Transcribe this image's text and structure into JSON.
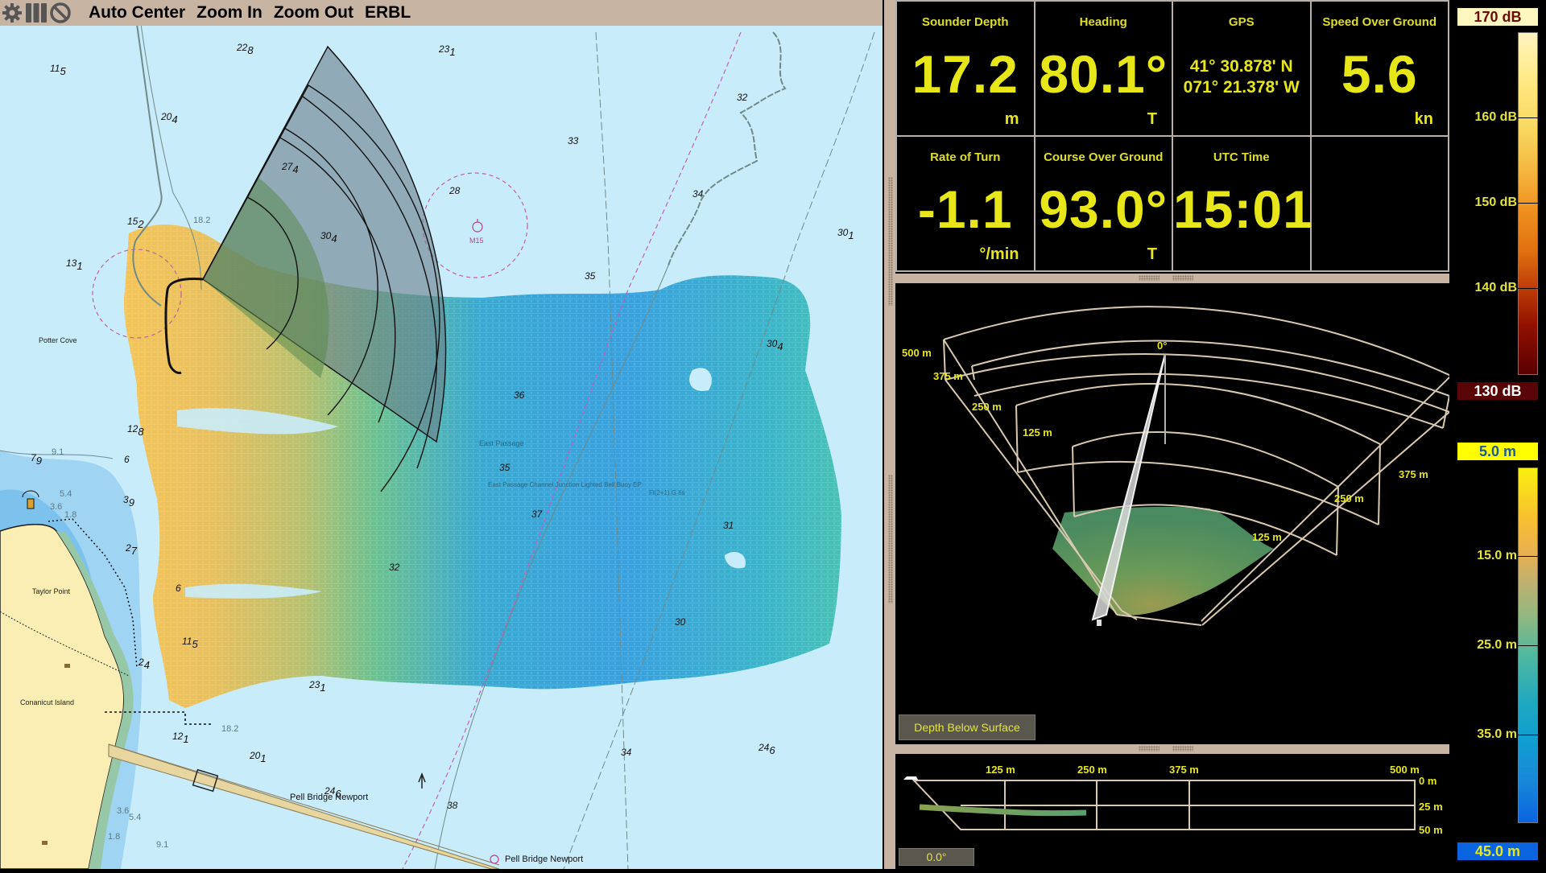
{
  "toolbar": {
    "icons": [
      "gear-icon",
      "columns-icon",
      "no-entry-icon"
    ],
    "buttons": [
      "Auto Center",
      "Zoom In",
      "Zoom Out",
      "ERBL"
    ]
  },
  "instruments": [
    {
      "label": "Sounder Depth",
      "value": "17.2",
      "unit": "m"
    },
    {
      "label": "Heading",
      "value": "80.1°",
      "unit": "T"
    },
    {
      "label": "GPS",
      "lat": "41° 30.878' N",
      "lon": "071° 21.378' W"
    },
    {
      "label": "Speed Over Ground",
      "value": "5.6",
      "unit": "kn"
    },
    {
      "label": "Rate of Turn",
      "value": "-1.1",
      "unit": "°/min"
    },
    {
      "label": "Course Over Ground",
      "value": "93.0°",
      "unit": "T"
    },
    {
      "label": "UTC Time",
      "value": "15:01",
      "unit": ""
    },
    {
      "label": "",
      "value": "",
      "unit": ""
    }
  ],
  "map": {
    "soundings": [
      {
        "t": "11",
        "s": "5"
      },
      {
        "t": "22",
        "s": "8"
      },
      {
        "t": "23",
        "s": "1"
      },
      {
        "t": "20",
        "s": "4"
      },
      {
        "t": "27",
        "s": "4"
      },
      {
        "t": "28",
        "s": ""
      },
      {
        "t": "30",
        "s": "4"
      },
      {
        "t": "15",
        "s": "2"
      },
      {
        "t": "13",
        "s": "1"
      },
      {
        "t": "33",
        "s": ""
      },
      {
        "t": "32",
        "s": ""
      },
      {
        "t": "34",
        "s": ""
      },
      {
        "t": "35",
        "s": ""
      },
      {
        "t": "30",
        "s": "1"
      },
      {
        "t": "12",
        "s": "8"
      },
      {
        "t": "7",
        "s": "9"
      },
      {
        "t": "6",
        "s": ""
      },
      {
        "t": "3",
        "s": "9"
      },
      {
        "t": "2",
        "s": "7"
      },
      {
        "t": "6",
        "s": ""
      },
      {
        "t": "2",
        "s": "4"
      },
      {
        "t": "12",
        "s": "1"
      },
      {
        "t": "20",
        "s": "1"
      },
      {
        "t": "23",
        "s": "1"
      },
      {
        "t": "24",
        "s": "6"
      },
      {
        "t": "38",
        "s": ""
      },
      {
        "t": "34",
        "s": ""
      },
      {
        "t": "24",
        "s": "6"
      },
      {
        "t": "30",
        "s": "4"
      },
      {
        "t": "36",
        "s": ""
      },
      {
        "t": "35",
        "s": ""
      },
      {
        "t": "37",
        "s": ""
      },
      {
        "t": "31",
        "s": ""
      },
      {
        "t": "32",
        "s": ""
      },
      {
        "t": "30",
        "s": ""
      },
      {
        "t": "11",
        "s": "5"
      }
    ],
    "contour_labels": [
      "18.2",
      "9.1",
      "5.4",
      "3.6",
      "1.8",
      "18.2",
      "9.1",
      "5.4",
      "3.6",
      "1.8"
    ],
    "places": [
      "Potter Cove",
      "Taylor Point",
      "Conanicut Island",
      "Pell Bridge Newport",
      "Pell Bridge Newport",
      "East Passage",
      "East Passage Channel Junction Lighted Bell Buoy EP",
      "Fl(2+1) G 6s"
    ],
    "buoy_label": "M15"
  },
  "view3d": {
    "ranges_left": [
      "500 m",
      "375 m",
      "250 m",
      "125 m"
    ],
    "ranges_right": [
      "375 m",
      "250 m",
      "125 m"
    ],
    "bearing": "0°",
    "mode_button": "Depth Below Surface"
  },
  "profile": {
    "range_labels": [
      "125 m",
      "250 m",
      "375 m",
      "500 m"
    ],
    "depth_labels": [
      "0 m",
      "25 m",
      "50 m"
    ],
    "angle_button": "0.0°"
  },
  "colorbars": {
    "db": {
      "top": "170 dB",
      "bottom": "130 dB",
      "ticks": [
        "160 dB",
        "150 dB",
        "140 dB"
      ],
      "top_bg": "#fff7c0",
      "top_fg": "#6a0a00",
      "bottom_bg": "#5a0505",
      "bottom_fg": "#ffffff"
    },
    "depth": {
      "top": "5.0 m",
      "bottom": "45.0 m",
      "ticks": [
        "15.0 m",
        "25.0 m",
        "35.0 m"
      ],
      "top_bg": "#ffff00",
      "top_fg": "#1a5aa0",
      "bottom_bg": "#0a64e0",
      "bottom_fg": "#e6e619"
    }
  }
}
